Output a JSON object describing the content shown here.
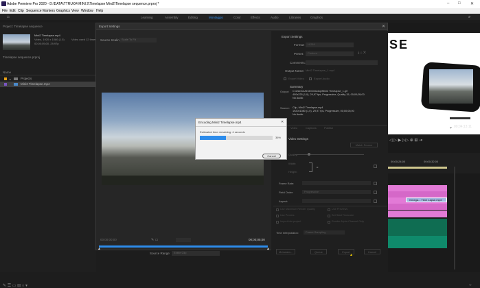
{
  "window": {
    "title": "Adobe Premiere Pro 2020 - D:\\DATA\\TTRU\\04 MINI 2\\Timelapse Mini2\\Timelapse sequence.prproj *"
  },
  "menu": [
    "File",
    "Edit",
    "Clip",
    "Sequence",
    "Markers",
    "Graphics",
    "View",
    "Window",
    "Help"
  ],
  "workspaces": [
    "Learning",
    "Assembly",
    "Editing",
    "Montaggio",
    "Color",
    "Effects",
    "Audio",
    "Libraries",
    "Graphics"
  ],
  "project": {
    "tab": "Project: Timelapse sequence",
    "clip_name": "Mini2 Timelapse.mp4",
    "clip_info": "Video, 1920 x 1080 (1.0)",
    "clip_info2": "00;00;05;00, 29,97p",
    "clip_used": "Video used 12 times",
    "project_file": "Timelapse sequence.prproj",
    "column_name": "Name",
    "items": [
      "Projects",
      "Mini2 Timelapse.mp4"
    ]
  },
  "dialog": {
    "title": "Export Settings",
    "source_scaling_label": "Source Scaling:",
    "source_scaling_value": "Scale To Fit",
    "export_settings": "Export Settings",
    "format_label": "Format:",
    "format_value": "H.264",
    "preset_label": "Preset:",
    "preset_value": "Custom",
    "comments_label": "Comments:",
    "output_name_label": "Output Name:",
    "output_name_value": "Mini2 Timelapse_1.mp4",
    "export_video": "Export Video",
    "export_audio": "Export Audio",
    "summary": "Summary",
    "output_label": "Output:",
    "output_line1": "C:\\Users\\Utente\\Desktop\\Mini2 Timelapse_1.gif",
    "output_line2": "400x225 (1,0), 29,97 fps, Progressive, Quality 15, 00;00;05;00",
    "output_line3": "No Audio",
    "source_label": "Source:",
    "source_line1": "Clip, Mini2 Timelapse.mp4",
    "source_line2": "1920x1080 (1,0), 29,97 fps, Progressive, 00;00;05;00",
    "source_line3": "No Audio",
    "tabs": [
      "Video",
      "Captions",
      "Publish"
    ],
    "video_settings": "Video Settings",
    "match_source": "Match Source",
    "quality_label": "Quality:",
    "width_label": "Width:",
    "height_label": "Height:",
    "frame_rate_label": "Frame Rate:",
    "field_order_label": "Field Order:",
    "field_order_value": "Progressive",
    "aspect_label": "Aspect:",
    "use_max_render": "Use Maximum Render Quality",
    "use_previews": "Use Previews",
    "use_proxies": "Use Proxies",
    "set_start_timecode": "Set Start Timecode",
    "render_alpha": "Render Alpha Channel Only",
    "import_into_project": "Import into project",
    "time_interp_label": "Time Interpolation:",
    "time_interp_value": "Frame Sampling",
    "timecode_start": "00;00;00;00",
    "timecode_end": "00;00;05;00",
    "source_range_label": "Source Range:",
    "source_range_value": "Entire Clip",
    "buttons": {
      "metadata": "Metadata...",
      "queue": "Queue",
      "export": "Export",
      "cancel": "Cancel"
    }
  },
  "progress": {
    "title": "Encoding Mini2 Timelapse.mp4",
    "estimate": "Estimated time remaining: 4 seconds",
    "percent": "36%",
    "fill": 0.36,
    "cancel": "Cancel"
  },
  "monitor": {
    "promo_text": "SE",
    "timecode": "00;04;13;11",
    "ruler": [
      "00;00;24;00",
      "00;00;32;00"
    ],
    "clip_label": "Omega... Time Lapse.mp4"
  },
  "colors": {
    "accent": "#2d8ceb",
    "pink": "#e27ad6",
    "green": "#0f8a6b"
  }
}
